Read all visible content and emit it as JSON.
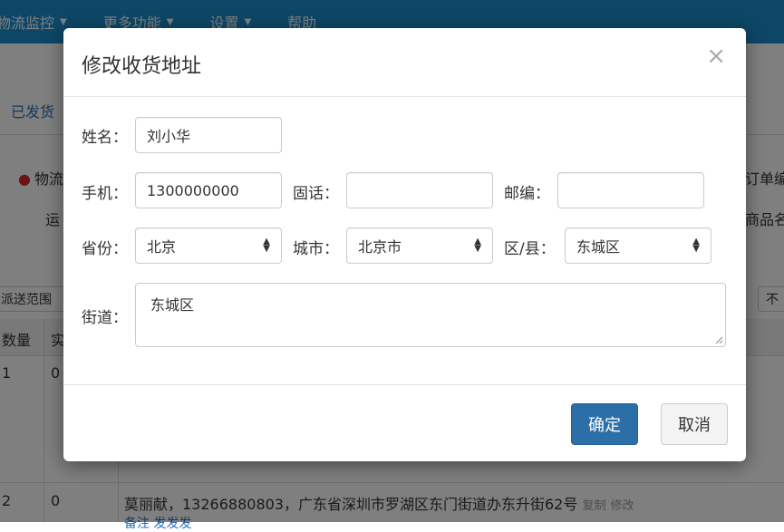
{
  "navbar": {
    "items": [
      "物流监控",
      "更多功能",
      "设置",
      "帮助"
    ]
  },
  "background": {
    "shipped_tab": "已发货",
    "logistics_label": "物流",
    "order_label": "订单编",
    "carrier_label": "运",
    "product_label": "商品名",
    "delivery_range": "派送范围",
    "not_label": "不",
    "col_qty": "数量",
    "col_actual": "实",
    "row1": {
      "qty": "1",
      "actual": "0"
    },
    "row2": {
      "qty": "2",
      "actual": "0",
      "address": "莫丽献，13266880803，广东省深圳市罗湖区东门街道办东升街62号",
      "copy": "复制",
      "edit": "修改",
      "note": "备注",
      "send": "发发发"
    }
  },
  "modal": {
    "title": "修改收货地址",
    "close_symbol": "×",
    "name_label": "姓名：",
    "name_value": "刘小华",
    "mobile_label": "手机：",
    "mobile_value": "1300000000",
    "phone_label": "固话：",
    "phone_value": "",
    "zip_label": "邮编：",
    "zip_value": "",
    "province_label": "省份：",
    "province_value": "北京",
    "city_label": "城市：",
    "city_value": "北京市",
    "district_label": "区/县：",
    "district_value": "东城区",
    "street_label": "街道：",
    "street_value": "东城区",
    "confirm_label": "确定",
    "cancel_label": "取消"
  }
}
